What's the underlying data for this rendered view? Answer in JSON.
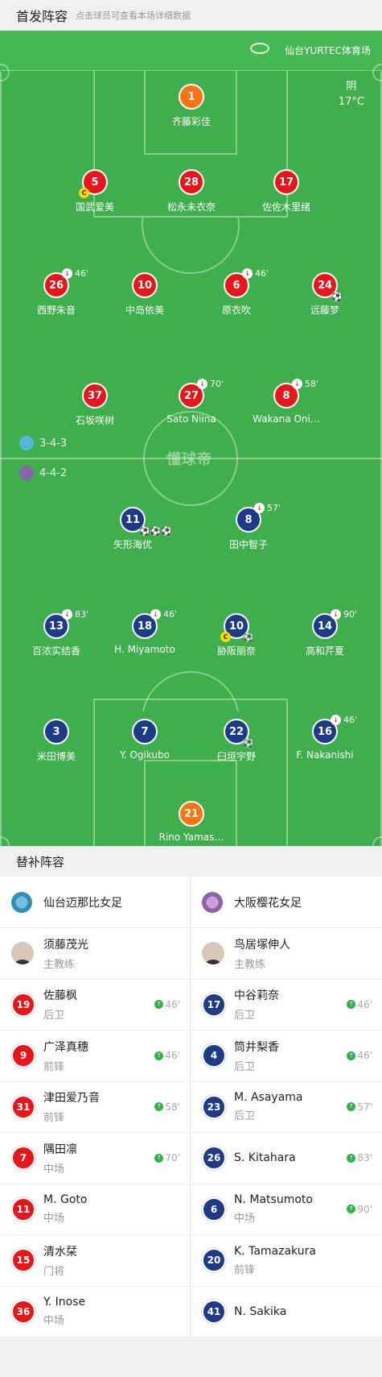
{
  "header": {
    "title": "首发阵容",
    "subtitle": "点击球员可查看本场详细数据"
  },
  "venue": {
    "name": "仙台YURTEC体育场",
    "icon": "stadium-icon"
  },
  "weather": {
    "condition": "阴",
    "temp": "17°C"
  },
  "watermark": "懂球帝",
  "home": {
    "formation": "3-4-3",
    "color": "#e8161b"
  },
  "away": {
    "formation": "4-4-2",
    "color": "#1d3b86"
  },
  "pitch_players": [
    {
      "num": "1",
      "name": "齐藤彩佳",
      "side": "gk-home"
    },
    {
      "num": "5",
      "name": "国武爱美",
      "side": "home",
      "captain": "C"
    },
    {
      "num": "28",
      "name": "松永未衣奈",
      "side": "home"
    },
    {
      "num": "17",
      "name": "佐佐木里绪",
      "side": "home"
    },
    {
      "num": "26",
      "name": "西野朱音",
      "side": "home",
      "sub": "46'"
    },
    {
      "num": "10",
      "name": "中岛依美",
      "side": "home"
    },
    {
      "num": "6",
      "name": "原衣吹",
      "side": "home",
      "sub": "46'"
    },
    {
      "num": "24",
      "name": "远藤梦",
      "side": "home",
      "ball": "⚽"
    },
    {
      "num": "37",
      "name": "石坂咲树",
      "side": "home"
    },
    {
      "num": "27",
      "name": "Sato Niina",
      "side": "home",
      "sub": "70'"
    },
    {
      "num": "8",
      "name": "Wakana Oni…",
      "side": "home",
      "sub": "58'"
    },
    {
      "num": "11",
      "name": "矢形海优",
      "side": "away",
      "ball": "⚽⚽⚽"
    },
    {
      "num": "8",
      "name": "田中智子",
      "side": "away",
      "sub": "57'"
    },
    {
      "num": "13",
      "name": "百浓实结香",
      "side": "away",
      "sub": "83'"
    },
    {
      "num": "18",
      "name": "H. Miyamoto",
      "side": "away",
      "sub": "46'"
    },
    {
      "num": "10",
      "name": "胁阪丽奈",
      "side": "away",
      "card": "C",
      "assist": true
    },
    {
      "num": "14",
      "name": "高和芹夏",
      "side": "away",
      "sub": "90'"
    },
    {
      "num": "3",
      "name": "米田博美",
      "side": "away"
    },
    {
      "num": "7",
      "name": "Y. Ogikubo",
      "side": "away"
    },
    {
      "num": "22",
      "name": "臼垣宇野",
      "side": "away",
      "assist": true
    },
    {
      "num": "16",
      "name": "F. Nakanishi",
      "side": "away",
      "sub": "46'"
    },
    {
      "num": "21",
      "name": "Rino Yamas…",
      "side": "gk-away"
    }
  ],
  "subs": {
    "title": "替补阵容",
    "home_team": "仙台迈那比女足",
    "away_team": "大阪樱花女足",
    "home_coach": {
      "name": "须藤茂光",
      "role": "主教练"
    },
    "away_coach": {
      "name": "鸟居塚伸人",
      "role": "主教练"
    },
    "home": [
      {
        "num": "19",
        "name": "佐藤枫",
        "pos": "后卫",
        "min": "46'"
      },
      {
        "num": "9",
        "name": "广泽真穗",
        "pos": "前锋",
        "min": "46'"
      },
      {
        "num": "31",
        "name": "津田爱乃音",
        "pos": "前锋",
        "min": "58'"
      },
      {
        "num": "7",
        "name": "隅田凛",
        "pos": "中场",
        "min": "70'"
      },
      {
        "num": "11",
        "name": "M. Goto",
        "pos": "中场",
        "min": ""
      },
      {
        "num": "15",
        "name": "清水栞",
        "pos": "门将",
        "min": ""
      },
      {
        "num": "36",
        "name": "Y. Inose",
        "pos": "中场",
        "min": ""
      }
    ],
    "away": [
      {
        "num": "17",
        "name": "中谷莉奈",
        "pos": "后卫",
        "min": "46'"
      },
      {
        "num": "4",
        "name": "筒井梨香",
        "pos": "后卫",
        "min": "46'"
      },
      {
        "num": "23",
        "name": "M. Asayama",
        "pos": "后卫",
        "min": "57'"
      },
      {
        "num": "26",
        "name": "S. Kitahara",
        "pos": "",
        "min": "83'"
      },
      {
        "num": "6",
        "name": "N. Matsumoto",
        "pos": "中场",
        "min": "90'"
      },
      {
        "num": "20",
        "name": "K. Tamazakura",
        "pos": "前锋",
        "min": ""
      },
      {
        "num": "41",
        "name": "N. Sakika",
        "pos": "",
        "min": ""
      }
    ]
  }
}
